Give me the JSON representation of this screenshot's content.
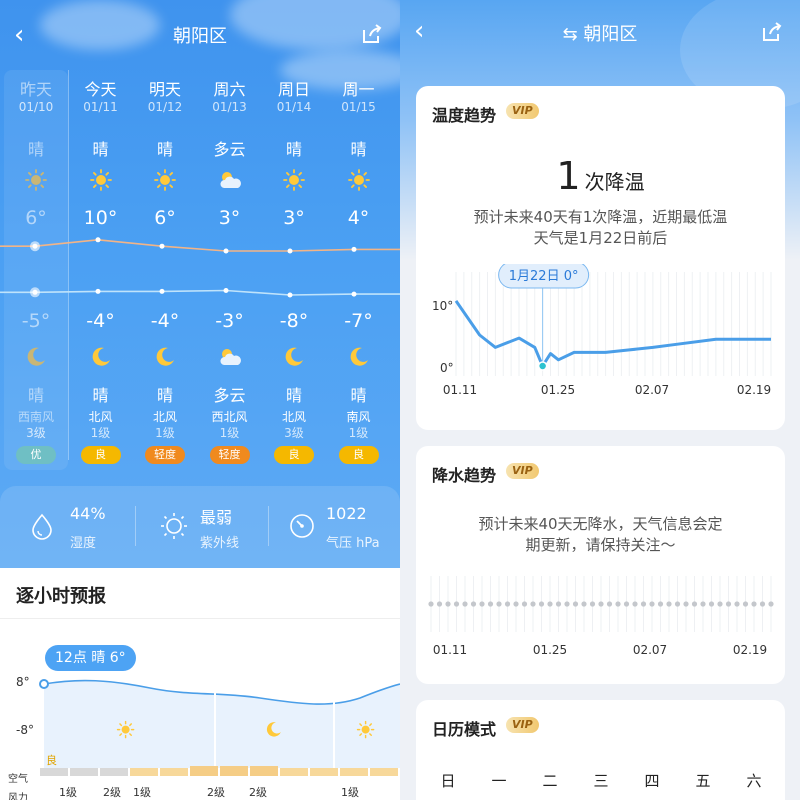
{
  "left": {
    "nav": {
      "title": "朝阳区",
      "back_glyph": "‹",
      "share_icon": "share-icon"
    },
    "days": [
      {
        "name": "昨天",
        "date": "01/10",
        "day_cond": "晴",
        "day_icon": "sun-dim-icon",
        "high": "6°",
        "low": "-5°",
        "night_icon": "moon-dim-icon",
        "night_cond": "晴",
        "wind": "西南风",
        "level": "3级",
        "aqi": "优",
        "aqi_color": "#6fbfc4",
        "past": true
      },
      {
        "name": "今天",
        "date": "01/11",
        "day_cond": "晴",
        "day_icon": "sun-icon",
        "high": "10°",
        "low": "-4°",
        "night_icon": "moon-icon",
        "night_cond": "晴",
        "wind": "北风",
        "level": "1级",
        "aqi": "良",
        "aqi_color": "#f5b800",
        "past": false
      },
      {
        "name": "明天",
        "date": "01/12",
        "day_cond": "晴",
        "day_icon": "sun-icon",
        "high": "6°",
        "low": "-4°",
        "night_icon": "moon-icon",
        "night_cond": "晴",
        "wind": "北风",
        "level": "1级",
        "aqi": "轻度",
        "aqi_color": "#f08a1e",
        "past": false
      },
      {
        "name": "周六",
        "date": "01/13",
        "day_cond": "多云",
        "day_icon": "cloud-sun-icon",
        "high": "3°",
        "low": "-3°",
        "night_icon": "cloud-sun-icon",
        "night_cond": "多云",
        "wind": "西北风",
        "level": "1级",
        "aqi": "轻度",
        "aqi_color": "#f08a1e",
        "past": false
      },
      {
        "name": "周日",
        "date": "01/14",
        "day_cond": "晴",
        "day_icon": "sun-icon",
        "high": "3°",
        "low": "-8°",
        "night_icon": "moon-icon",
        "night_cond": "晴",
        "wind": "北风",
        "level": "3级",
        "aqi": "良",
        "aqi_color": "#f5b800",
        "past": false
      },
      {
        "name": "周一",
        "date": "01/15",
        "day_cond": "晴",
        "day_icon": "sun-icon",
        "high": "4°",
        "low": "-7°",
        "night_icon": "moon-icon",
        "night_cond": "晴",
        "wind": "南风",
        "level": "1级",
        "aqi": "良",
        "aqi_color": "#f5b800",
        "past": false
      }
    ],
    "stats": [
      {
        "value": "44%",
        "label": "湿度",
        "icon": "water-drop-icon"
      },
      {
        "value": "最弱",
        "label": "紫外线",
        "icon": "sun-outline-icon"
      },
      {
        "value": "1022",
        "label": "气压 hPa",
        "icon": "gauge-icon"
      }
    ],
    "hourly": {
      "title": "逐小时预报",
      "tooltip": "12点 晴 6°",
      "y_high": "8°",
      "y_low": "-8°",
      "aqi_mark": "良",
      "row_air": "空气",
      "row_wind": "风力",
      "wind_levels": [
        "1级",
        "2级",
        "1级",
        "2级",
        "2级",
        "1级"
      ]
    }
  },
  "right": {
    "nav": {
      "title": "朝阳区",
      "switch_glyph": "⇆",
      "back_glyph": "‹",
      "share_icon": "share-icon"
    },
    "temp_card": {
      "title": "温度趋势",
      "vip": "VIP",
      "count": "1",
      "count_unit": "次降温",
      "desc_line1": "预计未来40天有1次降温，近期最低温",
      "desc_line2": "天气是1月22日前后",
      "tooltip": "1月22日 0°",
      "y_labels": [
        "10°",
        "0°"
      ],
      "x_labels": [
        "01.11",
        "01.25",
        "02.07",
        "02.19"
      ]
    },
    "rain_card": {
      "title": "降水趋势",
      "vip": "VIP",
      "desc_line1": "预计未来40天无降水，天气信息会定",
      "desc_line2": "期更新，请保持关注～",
      "x_labels": [
        "01.11",
        "01.25",
        "02.07",
        "02.19"
      ]
    },
    "calendar_card": {
      "title": "日历模式",
      "vip": "VIP",
      "weekdays": [
        "日",
        "一",
        "二",
        "三",
        "四",
        "五",
        "六"
      ]
    }
  },
  "chart_data": [
    {
      "type": "line",
      "x": [
        "01/10",
        "01/11",
        "01/12",
        "01/13",
        "01/14",
        "01/15"
      ],
      "series": [
        {
          "values": [
            6,
            10,
            6,
            3,
            3,
            4
          ]
        },
        {
          "values": [
            -5,
            -4,
            -4,
            -3,
            -8,
            -7
          ]
        }
      ],
      "ylabel": "",
      "xlabel": ""
    },
    {
      "type": "line",
      "title": "温度趋势",
      "x_ticks": [
        "01.11",
        "01.25",
        "02.07",
        "02.19"
      ],
      "ylim": [
        0,
        10
      ],
      "points": [
        [
          0,
          10.5
        ],
        [
          3,
          5
        ],
        [
          5,
          3
        ],
        [
          8,
          4.5
        ],
        [
          10,
          3
        ],
        [
          11,
          0
        ],
        [
          12,
          2
        ],
        [
          13,
          1
        ],
        [
          15,
          2.2
        ],
        [
          19,
          2.2
        ],
        [
          22,
          2.6
        ],
        [
          25,
          3
        ],
        [
          28,
          3.5
        ],
        [
          33,
          4.3
        ],
        [
          40,
          4.3
        ]
      ],
      "annotation": "1月22日 0°"
    },
    {
      "type": "line",
      "title": "降水趋势",
      "x_ticks": [
        "01.11",
        "01.25",
        "02.07",
        "02.19"
      ],
      "values": "all zero"
    }
  ]
}
